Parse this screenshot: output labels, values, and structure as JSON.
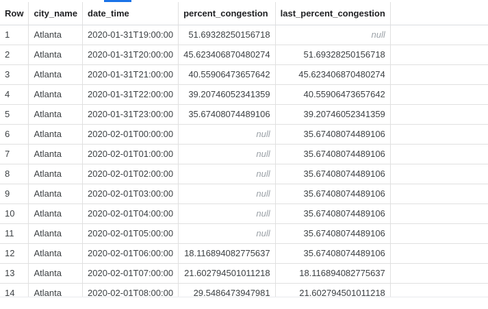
{
  "table": {
    "headers": [
      "Row",
      "city_name",
      "date_time",
      "percent_congestion",
      "last_percent_congestion"
    ],
    "rows": [
      [
        "1",
        "Atlanta",
        "2020-01-31T19:00:00",
        "51.69328250156718",
        "null"
      ],
      [
        "2",
        "Atlanta",
        "2020-01-31T20:00:00",
        "45.623406870480274",
        "51.69328250156718"
      ],
      [
        "3",
        "Atlanta",
        "2020-01-31T21:00:00",
        "40.55906473657642",
        "45.623406870480274"
      ],
      [
        "4",
        "Atlanta",
        "2020-01-31T22:00:00",
        "39.20746052341359",
        "40.55906473657642"
      ],
      [
        "5",
        "Atlanta",
        "2020-01-31T23:00:00",
        "35.67408074489106",
        "39.20746052341359"
      ],
      [
        "6",
        "Atlanta",
        "2020-02-01T00:00:00",
        "null",
        "35.67408074489106"
      ],
      [
        "7",
        "Atlanta",
        "2020-02-01T01:00:00",
        "null",
        "35.67408074489106"
      ],
      [
        "8",
        "Atlanta",
        "2020-02-01T02:00:00",
        "null",
        "35.67408074489106"
      ],
      [
        "9",
        "Atlanta",
        "2020-02-01T03:00:00",
        "null",
        "35.67408074489106"
      ],
      [
        "10",
        "Atlanta",
        "2020-02-01T04:00:00",
        "null",
        "35.67408074489106"
      ],
      [
        "11",
        "Atlanta",
        "2020-02-01T05:00:00",
        "null",
        "35.67408074489106"
      ],
      [
        "12",
        "Atlanta",
        "2020-02-01T06:00:00",
        "18.116894082775637",
        "35.67408074489106"
      ],
      [
        "13",
        "Atlanta",
        "2020-02-01T07:00:00",
        "21.602794501011218",
        "18.116894082775637"
      ],
      [
        "14",
        "Atlanta",
        "2020-02-01T08:00:00",
        "29.5486473947981",
        "21.602794501011218"
      ]
    ]
  },
  "colors": {
    "accent": "#1a73e8",
    "null_text": "#9aa0a6",
    "grid_line": "#e0e0e0"
  }
}
